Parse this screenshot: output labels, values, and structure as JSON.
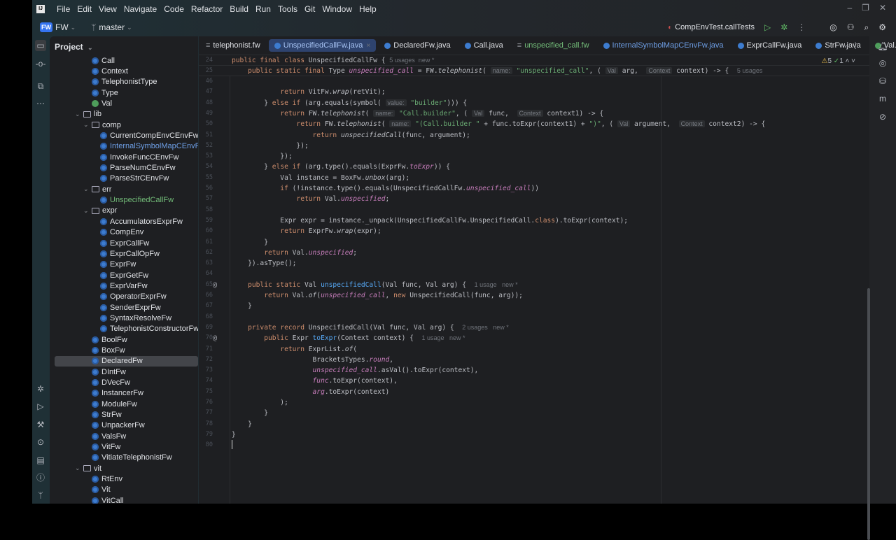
{
  "menu": [
    "File",
    "Edit",
    "View",
    "Navigate",
    "Code",
    "Refactor",
    "Build",
    "Run",
    "Tools",
    "Git",
    "Window",
    "Help"
  ],
  "toolbar": {
    "project_badge": "FW",
    "project": "FW",
    "branch": "master",
    "run_config": "CompEnvTest.callTests"
  },
  "project_panel": {
    "title": "Project",
    "items": [
      {
        "d": 4,
        "t": "Call",
        "ic": "class"
      },
      {
        "d": 4,
        "t": "Context",
        "ic": "class"
      },
      {
        "d": 4,
        "t": "TelephonistType",
        "ic": "class"
      },
      {
        "d": 4,
        "t": "Type",
        "ic": "class"
      },
      {
        "d": 4,
        "t": "Val",
        "ic": "iface"
      },
      {
        "d": 3,
        "t": "lib",
        "ic": "folder",
        "open": true
      },
      {
        "d": 4,
        "t": "comp",
        "ic": "folder",
        "open": true
      },
      {
        "d": 5,
        "t": "CurrentCompEnvCEnvFw",
        "ic": "class"
      },
      {
        "d": 5,
        "t": "InternalSymbolMapCEnvFw",
        "ic": "class",
        "c": "blue"
      },
      {
        "d": 5,
        "t": "InvokeFuncCEnvFw",
        "ic": "class"
      },
      {
        "d": 5,
        "t": "ParseNumCEnvFw",
        "ic": "class"
      },
      {
        "d": 5,
        "t": "ParseStrCEnvFw",
        "ic": "class"
      },
      {
        "d": 4,
        "t": "err",
        "ic": "folder",
        "open": true
      },
      {
        "d": 5,
        "t": "UnspecifiedCallFw",
        "ic": "class",
        "c": "green"
      },
      {
        "d": 4,
        "t": "expr",
        "ic": "folder",
        "open": true
      },
      {
        "d": 5,
        "t": "AccumulatorsExprFw",
        "ic": "class"
      },
      {
        "d": 5,
        "t": "CompEnv",
        "ic": "class"
      },
      {
        "d": 5,
        "t": "ExprCallFw",
        "ic": "class"
      },
      {
        "d": 5,
        "t": "ExprCallOpFw",
        "ic": "class"
      },
      {
        "d": 5,
        "t": "ExprFw",
        "ic": "class"
      },
      {
        "d": 5,
        "t": "ExprGetFw",
        "ic": "class"
      },
      {
        "d": 5,
        "t": "ExprVarFw",
        "ic": "class"
      },
      {
        "d": 5,
        "t": "OperatorExprFw",
        "ic": "class"
      },
      {
        "d": 5,
        "t": "SenderExprFw",
        "ic": "class"
      },
      {
        "d": 5,
        "t": "SyntaxResolveFw",
        "ic": "class"
      },
      {
        "d": 5,
        "t": "TelephonistConstructorFw",
        "ic": "class"
      },
      {
        "d": 4,
        "t": "BoolFw",
        "ic": "class"
      },
      {
        "d": 4,
        "t": "BoxFw",
        "ic": "class"
      },
      {
        "d": 4,
        "t": "DeclaredFw",
        "ic": "class",
        "sel": true
      },
      {
        "d": 4,
        "t": "DIntFw",
        "ic": "class"
      },
      {
        "d": 4,
        "t": "DVecFw",
        "ic": "class"
      },
      {
        "d": 4,
        "t": "InstancerFw",
        "ic": "class"
      },
      {
        "d": 4,
        "t": "ModuleFw",
        "ic": "class"
      },
      {
        "d": 4,
        "t": "StrFw",
        "ic": "class"
      },
      {
        "d": 4,
        "t": "UnpackerFw",
        "ic": "class"
      },
      {
        "d": 4,
        "t": "ValsFw",
        "ic": "class"
      },
      {
        "d": 4,
        "t": "VitFw",
        "ic": "class"
      },
      {
        "d": 4,
        "t": "VitiateTelephonistFw",
        "ic": "class"
      },
      {
        "d": 3,
        "t": "vit",
        "ic": "folder",
        "open": true
      },
      {
        "d": 4,
        "t": "RtEnv",
        "ic": "class"
      },
      {
        "d": 4,
        "t": "Vit",
        "ic": "class"
      },
      {
        "d": 4,
        "t": "VitCall",
        "ic": "class"
      }
    ]
  },
  "tabs": [
    {
      "label": "telephonist.fw",
      "ic": "file"
    },
    {
      "label": "UnspecifiedCallFw.java",
      "ic": "class",
      "active": true
    },
    {
      "label": "DeclaredFw.java",
      "ic": "class"
    },
    {
      "label": "Call.java",
      "ic": "class"
    },
    {
      "label": "unspecified_call.fw",
      "ic": "file",
      "c": "green"
    },
    {
      "label": "InternalSymbolMapCEnvFw.java",
      "ic": "class",
      "c": "blue"
    },
    {
      "label": "ExprCallFw.java",
      "ic": "class"
    },
    {
      "label": "StrFw.java",
      "ic": "class"
    },
    {
      "label": "Val.java",
      "ic": "iface"
    }
  ],
  "inspections": {
    "warnings": "5",
    "ok": "1"
  },
  "sticky": [
    {
      "n": "24",
      "seg": [
        [
          "k",
          "public final class "
        ],
        [
          "",
          "UnspecifiedCallFw { "
        ],
        [
          "u",
          "5 usages  new *"
        ]
      ]
    },
    {
      "n": "25",
      "seg": [
        [
          "k",
          "    public static final "
        ],
        [
          "",
          "Type "
        ],
        [
          "st",
          "unspecified_call"
        ],
        [
          "",
          " = FW."
        ],
        [
          "fi",
          "telephonist"
        ],
        [
          "",
          "( "
        ],
        [
          "h",
          "name:"
        ],
        [
          "s",
          " \"unspecified_call\""
        ],
        [
          "",
          ", ( "
        ],
        [
          "h",
          "Val"
        ],
        [
          "",
          " arg,  "
        ],
        [
          "h",
          "Context"
        ],
        [
          "",
          " context) -> {  "
        ],
        [
          "u",
          "5 usages"
        ]
      ]
    }
  ],
  "code": [
    {
      "n": "46",
      "seg": []
    },
    {
      "n": "47",
      "seg": [
        [
          "k",
          "            return "
        ],
        [
          "",
          "VitFw."
        ],
        [
          "fi",
          "wrap"
        ],
        [
          "",
          "(retVit);"
        ]
      ]
    },
    {
      "n": "48",
      "seg": [
        [
          "",
          "        } "
        ],
        [
          "k",
          "else if "
        ],
        [
          "",
          "(arg.equals(symbol( "
        ],
        [
          "h",
          "value:"
        ],
        [
          "s",
          " \"builder\""
        ],
        [
          "",
          "))) {"
        ]
      ]
    },
    {
      "n": "49",
      "seg": [
        [
          "k",
          "            return "
        ],
        [
          "",
          "FW."
        ],
        [
          "fi",
          "telephonist"
        ],
        [
          "",
          "( "
        ],
        [
          "h",
          "name:"
        ],
        [
          "s",
          " \"Call.builder\""
        ],
        [
          "",
          ", ( "
        ],
        [
          "h",
          "Val"
        ],
        [
          "",
          " func,  "
        ],
        [
          "h",
          "Context"
        ],
        [
          "",
          " context1) -> {"
        ]
      ]
    },
    {
      "n": "50",
      "seg": [
        [
          "k",
          "                return "
        ],
        [
          "",
          "FW."
        ],
        [
          "fi",
          "telephonist"
        ],
        [
          "",
          "( "
        ],
        [
          "h",
          "name:"
        ],
        [
          "s",
          " \"(Call.builder \""
        ],
        [
          "",
          " + func.toExpr(context1) + "
        ],
        [
          "s",
          "\")\""
        ],
        [
          "",
          ", ( "
        ],
        [
          "h",
          "Val"
        ],
        [
          "",
          " argument,  "
        ],
        [
          "h",
          "Context"
        ],
        [
          "",
          " context2) -> {"
        ]
      ]
    },
    {
      "n": "51",
      "seg": [
        [
          "k",
          "                    return "
        ],
        [
          "fi",
          "unspecifiedCall"
        ],
        [
          "",
          "(func, argument);"
        ]
      ]
    },
    {
      "n": "52",
      "seg": [
        [
          "",
          "                });"
        ]
      ]
    },
    {
      "n": "53",
      "seg": [
        [
          "",
          "            });"
        ]
      ]
    },
    {
      "n": "54",
      "seg": [
        [
          "",
          "        } "
        ],
        [
          "k",
          "else if "
        ],
        [
          "",
          "(arg.type().equals(ExprFw."
        ],
        [
          "st",
          "toExpr"
        ],
        [
          "",
          ")) {"
        ]
      ]
    },
    {
      "n": "55",
      "seg": [
        [
          "",
          "            Val instance = BoxFw."
        ],
        [
          "fi",
          "unbox"
        ],
        [
          "",
          "(arg);"
        ]
      ]
    },
    {
      "n": "56",
      "seg": [
        [
          "k",
          "            if "
        ],
        [
          "",
          "(!instance.type().equals(UnspecifiedCallFw."
        ],
        [
          "st",
          "unspecified_call"
        ],
        [
          "",
          "))"
        ]
      ]
    },
    {
      "n": "57",
      "seg": [
        [
          "k",
          "                return "
        ],
        [
          "",
          "Val."
        ],
        [
          "st",
          "unspecified"
        ],
        [
          "",
          ";"
        ]
      ]
    },
    {
      "n": "58",
      "seg": []
    },
    {
      "n": "59",
      "seg": [
        [
          "",
          "            Expr expr = instance._unpack(UnspecifiedCallFw.UnspecifiedCall."
        ],
        [
          "k",
          "class"
        ],
        [
          "",
          ").toExpr(context);"
        ]
      ]
    },
    {
      "n": "60",
      "seg": [
        [
          "k",
          "            return "
        ],
        [
          "",
          "ExprFw."
        ],
        [
          "fi",
          "wrap"
        ],
        [
          "",
          "(expr);"
        ]
      ]
    },
    {
      "n": "61",
      "seg": [
        [
          "",
          "        }"
        ]
      ]
    },
    {
      "n": "62",
      "seg": [
        [
          "k",
          "        return "
        ],
        [
          "",
          "Val."
        ],
        [
          "st",
          "unspecified"
        ],
        [
          "",
          ";"
        ]
      ]
    },
    {
      "n": "63",
      "seg": [
        [
          "",
          "    }).asType();"
        ]
      ]
    },
    {
      "n": "64",
      "seg": []
    },
    {
      "n": "65",
      "at": true,
      "seg": [
        [
          "k",
          "    public static "
        ],
        [
          "",
          "Val "
        ],
        [
          "m",
          "unspecifiedCall"
        ],
        [
          "",
          "(Val func, Val arg) {  "
        ],
        [
          "u",
          "1 usage   new *"
        ]
      ]
    },
    {
      "n": "66",
      "seg": [
        [
          "k",
          "        return "
        ],
        [
          "",
          "Val."
        ],
        [
          "fi",
          "of"
        ],
        [
          "",
          "("
        ],
        [
          "st",
          "unspecified_call"
        ],
        [
          "",
          ", "
        ],
        [
          "k",
          "new "
        ],
        [
          "",
          "UnspecifiedCall(func, arg));"
        ]
      ]
    },
    {
      "n": "67",
      "seg": [
        [
          "",
          "    }"
        ]
      ]
    },
    {
      "n": "68",
      "seg": []
    },
    {
      "n": "69",
      "seg": [
        [
          "k",
          "    private record "
        ],
        [
          "",
          "UnspecifiedCall(Val func, Val arg) {  "
        ],
        [
          "u",
          "2 usages   new *"
        ]
      ]
    },
    {
      "n": "70",
      "at": true,
      "seg": [
        [
          "k",
          "        public "
        ],
        [
          "",
          "Expr "
        ],
        [
          "m",
          "toExpr"
        ],
        [
          "",
          "(Context context) {  "
        ],
        [
          "u",
          "1 usage   new *"
        ]
      ]
    },
    {
      "n": "71",
      "seg": [
        [
          "k",
          "            return "
        ],
        [
          "",
          "ExprList."
        ],
        [
          "fi",
          "of"
        ],
        [
          "",
          "("
        ]
      ]
    },
    {
      "n": "72",
      "seg": [
        [
          "",
          "                    BracketsTypes."
        ],
        [
          "st",
          "round"
        ],
        [
          "",
          ","
        ]
      ]
    },
    {
      "n": "73",
      "seg": [
        [
          "st",
          "                    unspecified_call"
        ],
        [
          "",
          ".asVal().toExpr(context),"
        ]
      ]
    },
    {
      "n": "74",
      "seg": [
        [
          "st",
          "                    func"
        ],
        [
          "",
          ".toExpr(context),"
        ]
      ]
    },
    {
      "n": "75",
      "seg": [
        [
          "st",
          "                    arg"
        ],
        [
          "",
          ".toExpr(context)"
        ]
      ]
    },
    {
      "n": "76",
      "seg": [
        [
          "",
          "            );"
        ]
      ]
    },
    {
      "n": "77",
      "seg": [
        [
          "",
          "        }"
        ]
      ]
    },
    {
      "n": "78",
      "seg": [
        [
          "",
          "    }"
        ]
      ]
    },
    {
      "n": "79",
      "seg": [
        [
          "",
          "}"
        ]
      ]
    },
    {
      "n": "80",
      "seg": [],
      "cursor": true
    }
  ]
}
